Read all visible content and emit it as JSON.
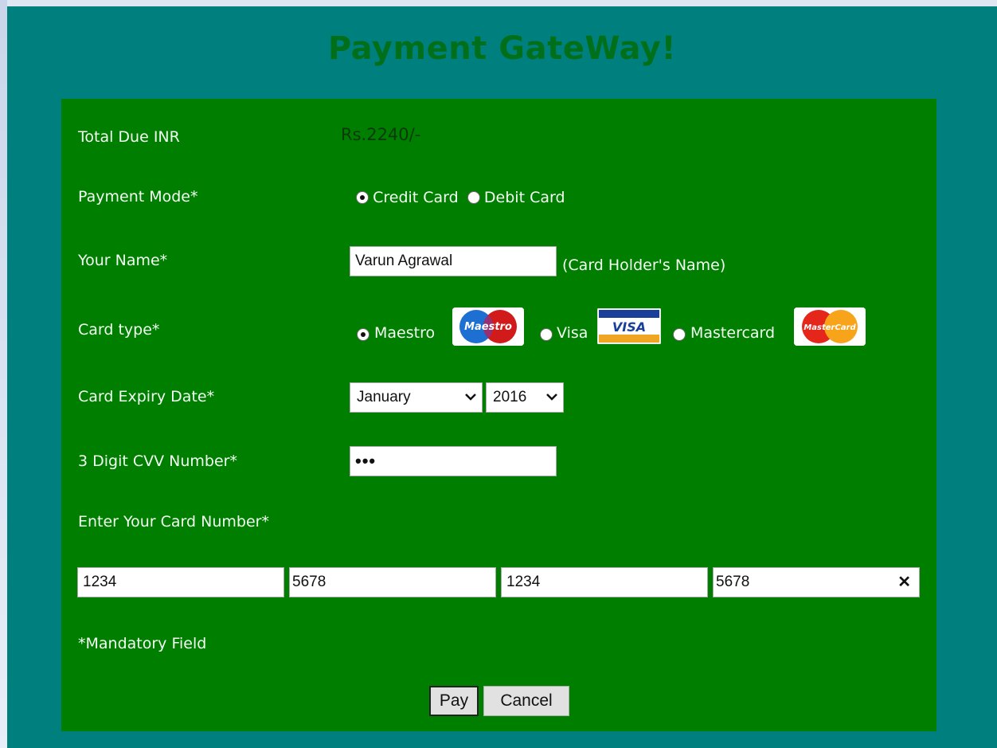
{
  "title": "Payment GateWay!",
  "total_due": {
    "label": "Total Due INR",
    "value": "Rs.2240/-"
  },
  "payment_mode": {
    "label": "Payment Mode*",
    "options": [
      {
        "label": "Credit Card",
        "selected": true
      },
      {
        "label": "Debit Card",
        "selected": false
      }
    ]
  },
  "name": {
    "label": "Your Name*",
    "value": "Varun Agrawal",
    "hint": "(Card Holder's Name)"
  },
  "card_type": {
    "label": "Card type*",
    "options": [
      {
        "label": "Maestro",
        "selected": true,
        "logo_text": "Maestro"
      },
      {
        "label": "Visa",
        "selected": false,
        "logo_text": "VISA"
      },
      {
        "label": "Mastercard",
        "selected": false,
        "logo_text": "MasterCard"
      }
    ]
  },
  "expiry": {
    "label": "Card Expiry Date*",
    "month": "January",
    "year": "2016"
  },
  "cvv": {
    "label": "3 Digit CVV Number*",
    "value": "•••"
  },
  "card_number": {
    "label": "Enter Your Card Number*",
    "parts": [
      "1234",
      "5678",
      "1234",
      "5678"
    ],
    "clear_glyph": "✕"
  },
  "mandatory_note": "*Mandatory Field",
  "buttons": {
    "pay": "Pay",
    "cancel": "Cancel"
  },
  "colors": {
    "page_bg": "#007f7f",
    "form_bg": "#007e00",
    "title": "#006f1a",
    "label_text": "#f2fff2"
  },
  "icons": [
    "radio-button",
    "chevron-down-icon",
    "clear-icon",
    "maestro-logo",
    "visa-logo",
    "mastercard-logo"
  ]
}
